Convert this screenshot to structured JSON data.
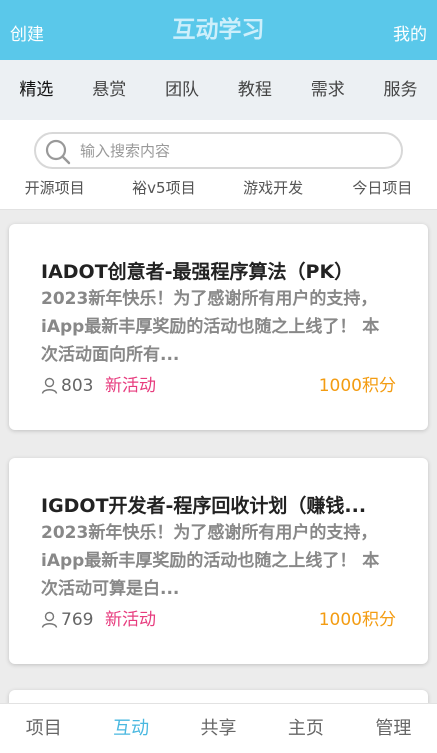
{
  "header": {
    "left": "创建",
    "title": "互动学习",
    "right": "我的"
  },
  "categories": [
    "精选",
    "悬赏",
    "团队",
    "教程",
    "需求",
    "服务"
  ],
  "search": {
    "placeholder": "输入搜索内容"
  },
  "quick_links": [
    "开源项目",
    "裕v5项目",
    "游戏开发",
    "今日项目"
  ],
  "cards": [
    {
      "title": "IADOT创意者-最强程序算法（PK）",
      "desc": "2023新年快乐！为了感谢所有用户的支持，iApp最新丰厚奖励的活动也随之上线了！ 本次活动面向所有...",
      "count": "803",
      "tag": "新活动",
      "points": "1000积分"
    },
    {
      "title": "IGDOT开发者-程序回收计划（赚钱...",
      "desc": "2023新年快乐！为了感谢所有用户的支持，iApp最新丰厚奖励的活动也随之上线了！ 本次活动可算是白...",
      "count": "769",
      "tag": "新活动",
      "points": "1000积分"
    }
  ],
  "bottom_tabs": [
    "项目",
    "互动",
    "共享",
    "主页",
    "管理"
  ],
  "colors": {
    "header": "#5ac8ea",
    "tag": "#e73c7e",
    "points": "#f39c12",
    "active_tab": "#4ab8e0"
  }
}
